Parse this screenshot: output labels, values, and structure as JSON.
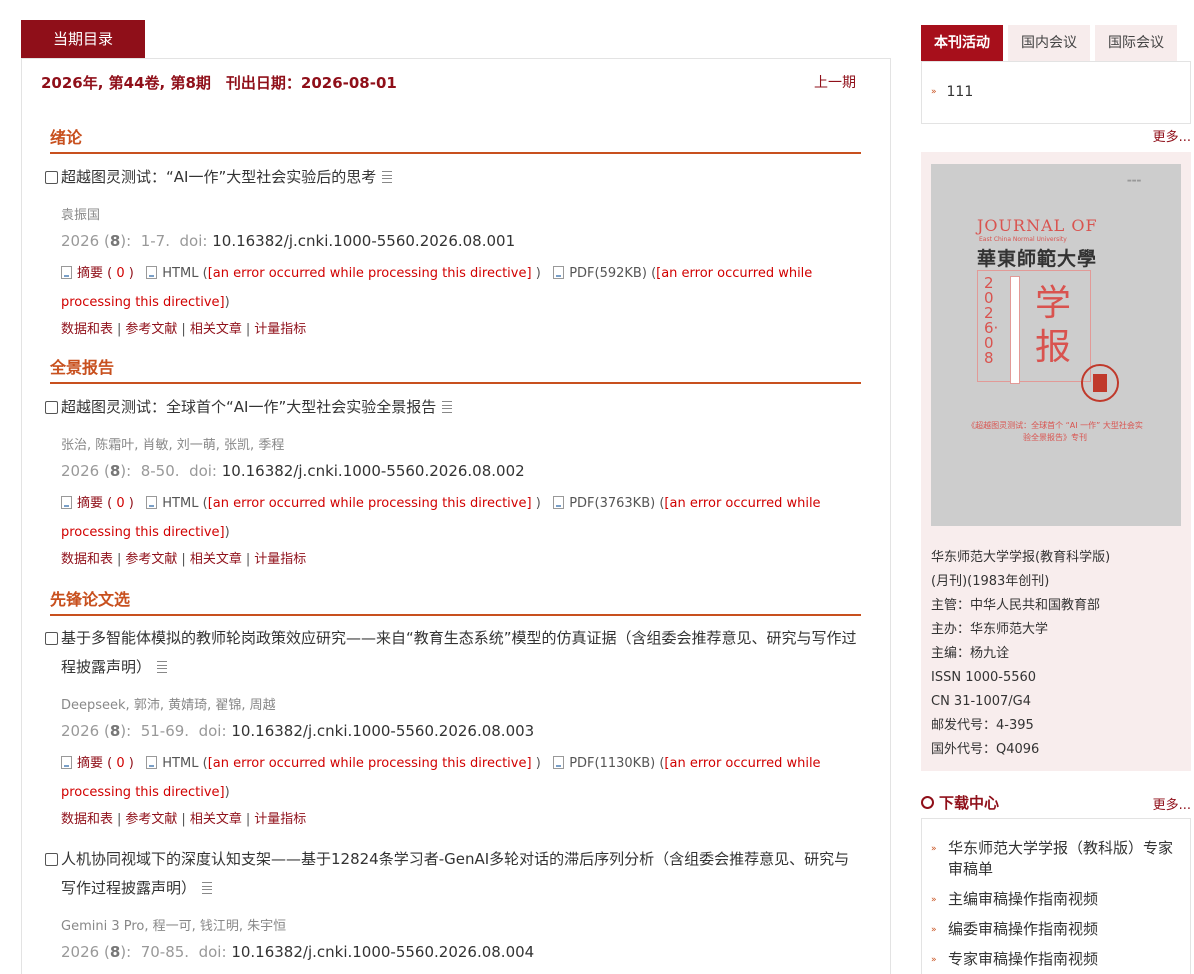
{
  "current_issue": {
    "tab_label": "当期目录",
    "issue_info": "2026年, 第44卷, 第8期　刊出日期：2026-08-01",
    "prev_issue_label": "上一期"
  },
  "sections": [
    {
      "title": "绪论"
    },
    {
      "title": "全景报告"
    },
    {
      "title": "先锋论文选"
    }
  ],
  "labels": {
    "abstract": "摘要",
    "abstract_open": "(",
    "abstract_count": "0",
    "abstract_close": ")",
    "html": "HTML",
    "paren_open": "(",
    "error": "[an error occurred while processing this directive]",
    "paren_close": ")",
    "data_tables": "数据和表",
    "references": "参考文献",
    "related": "相关文章",
    "metrics": "计量指标",
    "sep": "|",
    "doi_label": "doi:"
  },
  "articles": [
    {
      "title": "超越图灵测试：“AI一作”大型社会实验后的思考",
      "authors": "袁振国",
      "year": "2026",
      "issue_no": "8",
      "pages": "1-7.",
      "doi": "10.16382/j.cnki.1000-5560.2026.08.001",
      "pdf": "PDF(592KB)"
    },
    {
      "title": "超越图灵测试：全球首个“AI一作”大型社会实验全景报告",
      "authors": "张治, 陈霜叶, 肖敏, 刘一萌, 张凯, 季程",
      "year": "2026",
      "issue_no": "8",
      "pages": "8-50.",
      "doi": "10.16382/j.cnki.1000-5560.2026.08.002",
      "pdf": "PDF(3763KB)"
    },
    {
      "title": "基于多智能体模拟的教师轮岗政策效应研究——来自“教育生态系统”模型的仿真证据（含组委会推荐意见、研究与写作过程披露声明）",
      "authors": "Deepseek, 郭沛, 黄婧琦, 翟锦, 周越",
      "year": "2026",
      "issue_no": "8",
      "pages": "51-69.",
      "doi": "10.16382/j.cnki.1000-5560.2026.08.003",
      "pdf": "PDF(1130KB)"
    },
    {
      "title": "人机协同视域下的深度认知支架——基于12824条学习者-GenAI多轮对话的滞后序列分析（含组委会推荐意见、研究与写作过程披露声明）",
      "authors": "Gemini 3 Pro, 程一可, 钱江明, 朱宇恒",
      "year": "2026",
      "issue_no": "8",
      "pages": "70-85.",
      "doi": "10.16382/j.cnki.1000-5560.2026.08.004"
    }
  ],
  "right_tabs": [
    "本刊活动",
    "国内会议",
    "国际会议"
  ],
  "activities": [
    "111"
  ],
  "more_label": "更多...",
  "cover": {
    "journal_of": "JOURNAL OF",
    "subtitle": "East China Normal University",
    "cn_name": "華東師範大學",
    "year_issue": "2026·08",
    "xuebao": "学报",
    "caption": "《超越图灵测试：全球首个 “AI 一作” 大型社会实验全景报告》专刊"
  },
  "journal_info": [
    "华东师范大学学报(教育科学版)",
    "(月刊)(1983年创刊)",
    "主管：中华人民共和国教育部",
    "主办：华东师范大学",
    "主编：杨九诠",
    "ISSN 1000-5560",
    "CN 31-1007/G4",
    "邮发代号：4-395",
    "国外代号：Q4096"
  ],
  "download_center": {
    "title": "下载中心",
    "items": [
      "华东师范大学学报（教科版）专家审稿单",
      "主编审稿操作指南视频",
      "编委审稿操作指南视频",
      "专家审稿操作指南视频"
    ]
  }
}
